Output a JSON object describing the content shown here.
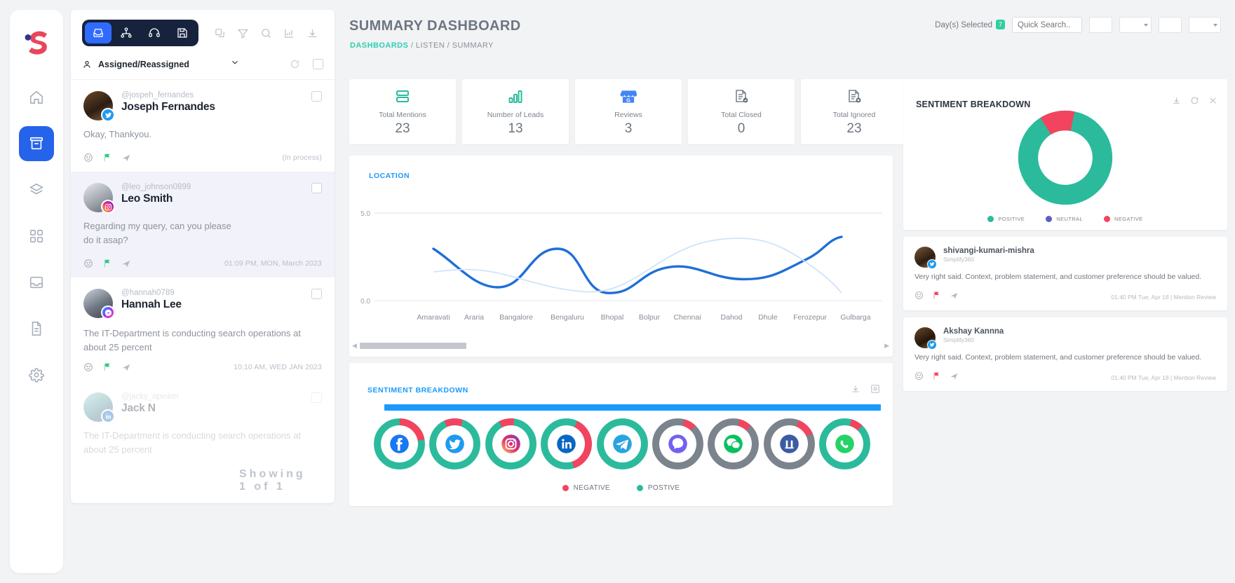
{
  "rail": {
    "logo_icon": "simplify360-logo-icon",
    "items": [
      {
        "name": "home",
        "icon": "home-icon",
        "active": false
      },
      {
        "name": "inbox",
        "icon": "archive-inbox-icon",
        "active": true
      },
      {
        "name": "layers",
        "icon": "layers-icon",
        "active": false
      },
      {
        "name": "apps",
        "icon": "grid-apps-icon",
        "active": false
      },
      {
        "name": "publish",
        "icon": "outbox-publish-icon",
        "active": false
      },
      {
        "name": "reports",
        "icon": "document-icon",
        "active": false
      },
      {
        "name": "settings",
        "icon": "gear-icon",
        "active": false
      }
    ]
  },
  "inbox": {
    "segments": [
      {
        "name": "inbox",
        "icon": "inbox-tray-icon",
        "active": true
      },
      {
        "name": "workflow",
        "icon": "sitemap-icon",
        "active": false
      },
      {
        "name": "support",
        "icon": "headset-icon",
        "active": false
      },
      {
        "name": "saved",
        "icon": "save-disk-icon",
        "active": false
      }
    ],
    "tools": [
      {
        "name": "copy",
        "icon": "copy-icon"
      },
      {
        "name": "filter",
        "icon": "funnel-filter-icon"
      },
      {
        "name": "search",
        "icon": "search-icon"
      },
      {
        "name": "analytics",
        "icon": "bar-chart-icon"
      },
      {
        "name": "download",
        "icon": "download-icon"
      }
    ],
    "filter_label": "Assigned/Reassigned",
    "conversations": [
      {
        "handle": "@jospeh_fernandes",
        "name": "Joseph Fernandes",
        "message": "Okay, Thankyou.",
        "network": "twitter",
        "timestamp": "(In process)",
        "selected": false
      },
      {
        "handle": "@leo_johnson0899",
        "name": "Leo Smith",
        "message": "Regarding my query, can you please do it asap?",
        "network": "instagram",
        "timestamp": "01:09 PM, MON, March 2023",
        "selected": true
      },
      {
        "handle": "@hannah0789",
        "name": "Hannah Lee",
        "message": "The IT-Department is conducting search operations at about 25 percent",
        "network": "messenger",
        "timestamp": "10:10 AM, WED JAN 2023",
        "selected": false
      },
      {
        "handle": "@jacky_opinion",
        "name": "Jack N",
        "message": "The IT-Department is conducting search operations at about 25 percent",
        "network": "linkedin",
        "timestamp": "",
        "selected": false
      }
    ],
    "showing_label": "Showing 1 of 1"
  },
  "header": {
    "title": "SUMMARY DASHBOARD",
    "breadcrumb": [
      {
        "label": "DASHBOARDS",
        "highlight": true
      },
      {
        "label": "LISTEN",
        "highlight": false
      },
      {
        "label": "SUMMARY",
        "highlight": false
      }
    ],
    "days_selected_label": "Day(s) Selected",
    "days_selected_count": "7",
    "quick_search_placeholder": "Quick Search..",
    "quick_search_value": ""
  },
  "kpis": [
    {
      "label": "Total Mentions",
      "value": "23",
      "icon": "mentions-rows-icon"
    },
    {
      "label": "Number of Leads",
      "value": "13",
      "icon": "leads-bars-icon"
    },
    {
      "label": "Reviews",
      "value": "3",
      "icon": "google-my-business-icon"
    },
    {
      "label": "Total Closed",
      "value": "0",
      "icon": "document-check-icon"
    },
    {
      "label": "Total Ignored",
      "value": "23",
      "icon": "document-x-icon"
    }
  ],
  "location_card": {
    "title": "LOCATION",
    "scroll_thumb_label": "horizontal-scrollbar"
  },
  "sentiment_bottom": {
    "title": "SENTIMENT BREAKDOWN",
    "download_icon": "download-icon",
    "expand_icon": "expand-icon",
    "legend": [
      {
        "label": "NEGATIVE",
        "color": "#f2445f"
      },
      {
        "label": "POSTIVE",
        "color": "#2bbb9c"
      }
    ],
    "channels": [
      {
        "name": "facebook",
        "positive": 78,
        "negative": 22,
        "brand": "#1877f2"
      },
      {
        "name": "twitter",
        "positive": 88,
        "negative": 12,
        "brand": "#1d9bf0"
      },
      {
        "name": "instagram",
        "positive": 90,
        "negative": 10,
        "brand": "#e1306c"
      },
      {
        "name": "linkedin",
        "positive": 62,
        "negative": 38,
        "brand": "#0a66c2"
      },
      {
        "name": "telegram",
        "positive": 100,
        "negative": 0,
        "brand": "#2aa3e0"
      },
      {
        "name": "viber",
        "positive": 0,
        "negative": 8,
        "brand": "#7360f2"
      },
      {
        "name": "wechat",
        "positive": 0,
        "negative": 8,
        "brand": "#07c160"
      },
      {
        "name": "mixi",
        "positive": 88,
        "negative": 12,
        "brand": "#3b5ba5"
      },
      {
        "name": "whatsapp",
        "positive": 92,
        "negative": 8,
        "brand": "#25d366"
      }
    ]
  },
  "sentiment_panel": {
    "title": "SENTIMENT BREAKDOWN",
    "actions": [
      {
        "name": "download",
        "icon": "download-icon"
      },
      {
        "name": "refresh",
        "icon": "refresh-icon"
      },
      {
        "name": "close",
        "icon": "close-icon"
      }
    ],
    "legend": [
      {
        "label": "POSITIVE",
        "color": "#2bbb9c"
      },
      {
        "label": "NEUTRAL",
        "color": "#5b5fc7"
      },
      {
        "label": "NEGATIVE",
        "color": "#f2445f"
      }
    ]
  },
  "reviews": [
    {
      "name": "shivangi-kumari-mishra",
      "sub": "Simplify360",
      "body": "Very right said. Context, problem statement, and customer preference should be valued.",
      "network": "twitter",
      "timestamp": "01:40 PM Tue, Apr 18 | Mention Review"
    },
    {
      "name": "Akshay Kannna",
      "sub": "Simplify360",
      "body": "Very right said. Context, problem statement, and customer preference should be valued.",
      "network": "twitter",
      "timestamp": "01:40 PM Tue, Apr 18 | Mention Review"
    }
  ],
  "chart_data": [
    {
      "type": "line",
      "title": "LOCATION",
      "xlabel": "",
      "ylabel": "",
      "ylim": [
        0.0,
        5.0
      ],
      "yticks": [
        "0.0",
        "5.0"
      ],
      "grid": true,
      "legend": "none",
      "categories": [
        "Amaravati",
        "Araria",
        "Bangalore",
        "Bengaluru",
        "Bhopal",
        "Bolpur",
        "Chennai",
        "Dahod",
        "Dhule",
        "Ferozepur",
        "Gulbarga"
      ],
      "series": [
        {
          "name": "mentions",
          "color": "#1f6fd6",
          "values": [
            3.0,
            1.4,
            2.5,
            1.0,
            1.6,
            2.0,
            1.7,
            2.1,
            1.6,
            2.4,
            3.4
          ]
        },
        {
          "name": "baseline",
          "color": "#cfe4fa",
          "values": [
            2.1,
            2.1,
            1.9,
            1.4,
            1.2,
            1.5,
            2.4,
            3.1,
            3.3,
            3.0,
            1.8
          ]
        }
      ]
    },
    {
      "type": "pie",
      "title": "SENTIMENT BREAKDOWN",
      "donut": true,
      "labels": [
        "POSITIVE",
        "NEUTRAL",
        "NEGATIVE"
      ],
      "values": [
        88,
        0,
        12
      ],
      "colors": [
        "#2bbb9c",
        "#5b5fc7",
        "#f2445f"
      ]
    },
    {
      "type": "bar",
      "title": "SENTIMENT BREAKDOWN",
      "subtype": "channel-donuts",
      "categories": [
        "facebook",
        "twitter",
        "instagram",
        "linkedin",
        "telegram",
        "viber",
        "wechat",
        "mixi",
        "whatsapp"
      ],
      "series": [
        {
          "name": "POSTIVE",
          "color": "#2bbb9c",
          "values": [
            78,
            88,
            90,
            62,
            100,
            0,
            0,
            88,
            92
          ]
        },
        {
          "name": "NEGATIVE",
          "color": "#f2445f",
          "values": [
            22,
            12,
            10,
            38,
            0,
            8,
            8,
            12,
            8
          ]
        }
      ]
    }
  ]
}
